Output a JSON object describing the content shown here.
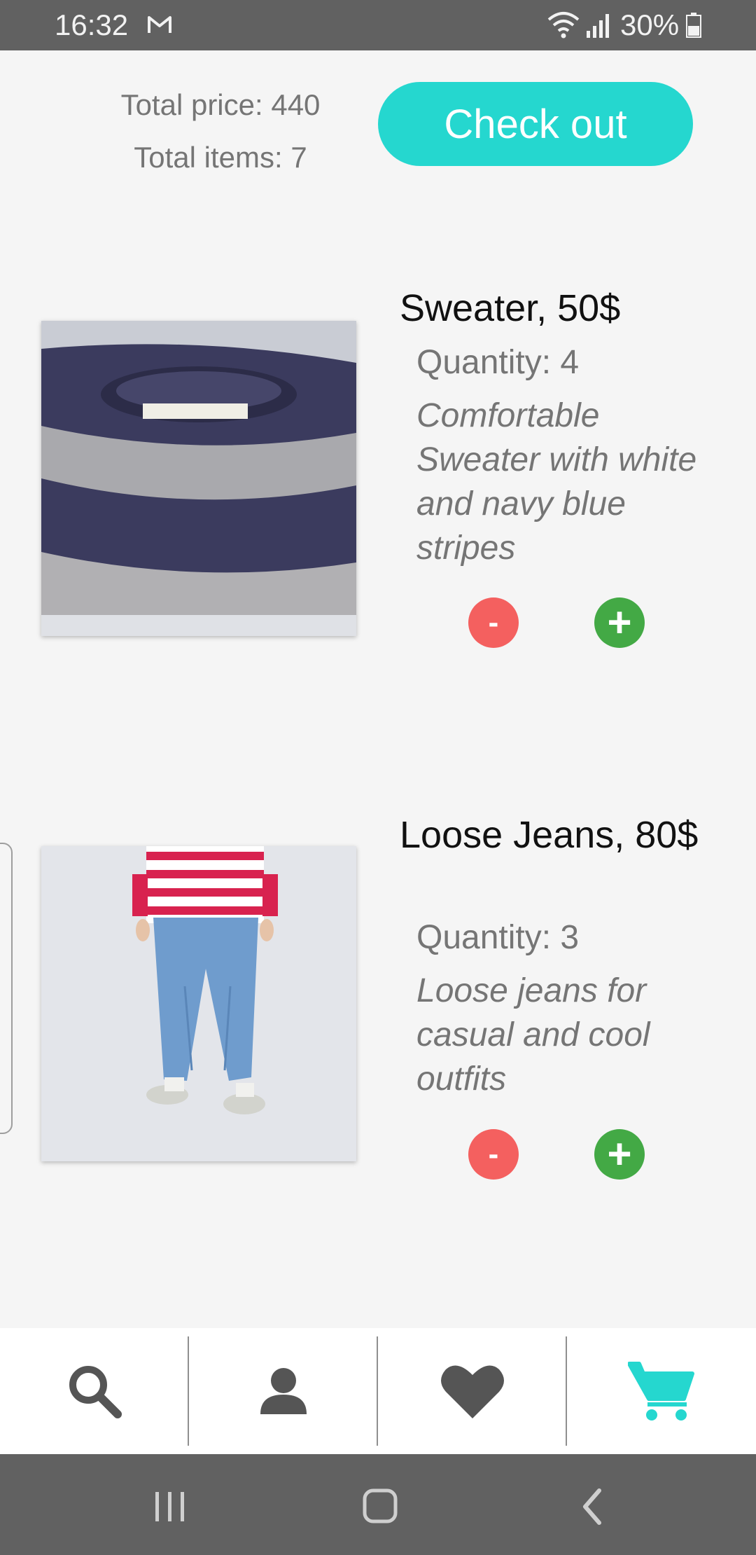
{
  "status_bar": {
    "time": "16:32",
    "battery": "30%",
    "icons": [
      "gmail-icon",
      "wifi-icon",
      "signal-icon",
      "battery-icon"
    ]
  },
  "summary": {
    "total_price": "Total price: 440",
    "total_items": "Total items: 7"
  },
  "checkout_label": "Check out",
  "products": [
    {
      "name": "Sweater, 50$",
      "quantity": "Quantity: 4",
      "description": "Comfortable Sweater with white and navy blue stripes",
      "minus_label": "-",
      "plus_label": "+"
    },
    {
      "name": "Loose Jeans, 80$",
      "quantity": "Quantity: 3",
      "description": "Loose jeans for casual and cool outfits",
      "minus_label": "-",
      "plus_label": "+"
    }
  ],
  "bottom_nav": {
    "items": [
      "search-icon",
      "profile-icon",
      "favorites-icon",
      "cart-icon"
    ],
    "active": "cart-icon"
  },
  "colors": {
    "accent": "#25d7cf",
    "minus": "#f4605f",
    "plus": "#43a945",
    "bars": "#616161"
  }
}
